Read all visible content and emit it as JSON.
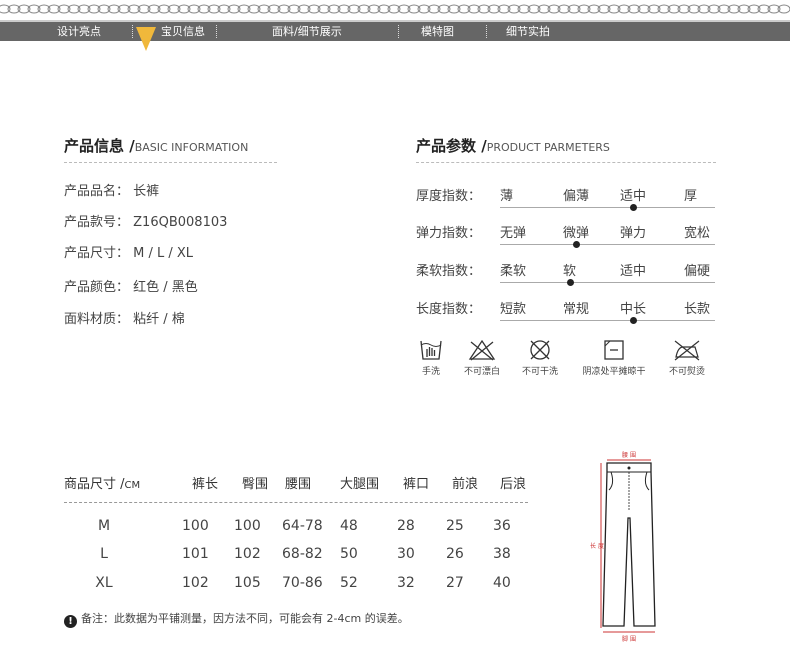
{
  "nav": {
    "items": [
      "设计亮点",
      "宝贝信息",
      "面料/细节展示",
      "模特图",
      "细节实拍"
    ]
  },
  "basic_info": {
    "title": "产品信息 /",
    "title_en": "BASIC INFORMATION",
    "rows": [
      {
        "label": "产品品名：",
        "value": "长裤"
      },
      {
        "label": "产品款号：",
        "value": "Z16QB008103"
      },
      {
        "label": "产品尺寸：",
        "value": "M / L / XL"
      },
      {
        "label": "产品颜色：",
        "value": "红色 / 黑色"
      },
      {
        "label": "面料材质：",
        "value": "粘纤 / 棉"
      }
    ]
  },
  "params": {
    "title": "产品参数 /",
    "title_en": "PRODUCT PARMETERS",
    "rows": [
      {
        "label": "厚度指数：",
        "options": [
          "薄",
          "偏薄",
          "适中",
          "厚"
        ],
        "selected": 2
      },
      {
        "label": "弹力指数：",
        "options": [
          "无弹",
          "微弹",
          "弹力",
          "宽松"
        ],
        "selected": 1
      },
      {
        "label": "柔软指数：",
        "options": [
          "柔软",
          "软",
          "适中",
          "偏硬"
        ],
        "selected": 1
      },
      {
        "label": "长度指数：",
        "options": [
          "短款",
          "常规",
          "中长",
          "长款"
        ],
        "selected": 2
      }
    ],
    "care": [
      {
        "icon": "hand-wash-icon",
        "label": "手洗"
      },
      {
        "icon": "no-bleach-icon",
        "label": "不可漂白"
      },
      {
        "icon": "no-tumble-dry-icon",
        "label": "不可干洗"
      },
      {
        "icon": "flat-dry-shade-icon",
        "label": "阴凉处平摊晾干"
      },
      {
        "icon": "no-iron-icon",
        "label": "不可熨烫"
      }
    ]
  },
  "size_table": {
    "header_first": "商品尺寸 /",
    "header_unit": "CM",
    "columns": [
      "裤长",
      "臀围",
      "腰围",
      "大腿围",
      "裤口",
      "前浪",
      "后浪"
    ],
    "rows": [
      {
        "size": "M",
        "values": [
          "100",
          "100",
          "64-78",
          "48",
          "28",
          "25",
          "36"
        ]
      },
      {
        "size": "L",
        "values": [
          "101",
          "102",
          "68-82",
          "50",
          "30",
          "26",
          "38"
        ]
      },
      {
        "size": "XL",
        "values": [
          "102",
          "105",
          "70-86",
          "52",
          "32",
          "27",
          "40"
        ]
      }
    ]
  },
  "note": "备注：此数据为平铺测量，因方法不同，可能会有 2-4cm 的误差。",
  "diagram": {
    "top_label": "腰 围",
    "side_label": "长 度",
    "bottom_label": "脚 围"
  }
}
